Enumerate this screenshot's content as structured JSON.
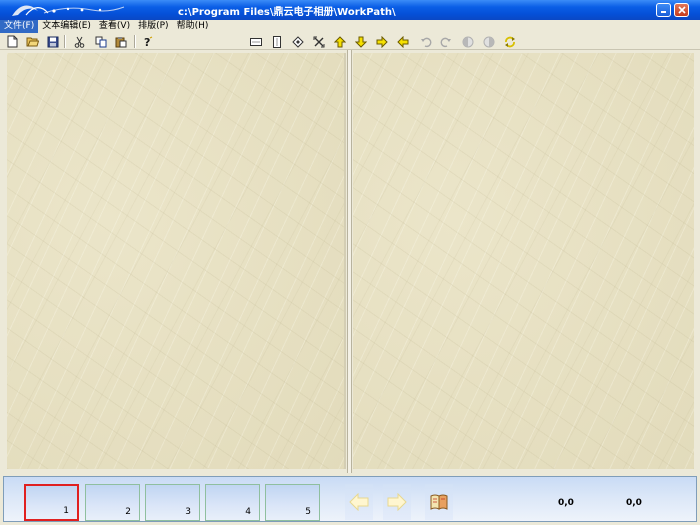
{
  "window": {
    "title": "c:\\Program Files\\鼎云电子相册\\WorkPath\\"
  },
  "menu": [
    {
      "label": "文件(F)"
    },
    {
      "label": "文本编辑(E)"
    },
    {
      "label": "查看(V)"
    },
    {
      "label": "排版(P)"
    },
    {
      "label": "帮助(H)"
    }
  ],
  "toolbar": {
    "left": [
      "new-file-icon",
      "open-folder-icon",
      "save-icon",
      "cut-icon",
      "copy-icon",
      "paste-icon",
      "help-icon"
    ],
    "right": [
      "dotted-row-icon",
      "dotted-column-icon",
      "diamond-icon",
      "cross-arrows-icon",
      "arrow-up-icon",
      "arrow-down-icon",
      "arrow-right-icon",
      "arrow-left-icon",
      "undo-icon",
      "redo-icon",
      "half-circle-left-icon",
      "half-circle-right-icon",
      "refresh-icon"
    ]
  },
  "thumbnails": [
    {
      "number": "1"
    },
    {
      "number": "2"
    },
    {
      "number": "3"
    },
    {
      "number": "4"
    },
    {
      "number": "5"
    }
  ],
  "status": {
    "coord_left": "0,0",
    "coord_right": "0,0"
  },
  "colors": {
    "titlebar": "#0a5ee6",
    "selected_thumb_border": "#e02020",
    "page_bg": "#e6dfc0"
  }
}
